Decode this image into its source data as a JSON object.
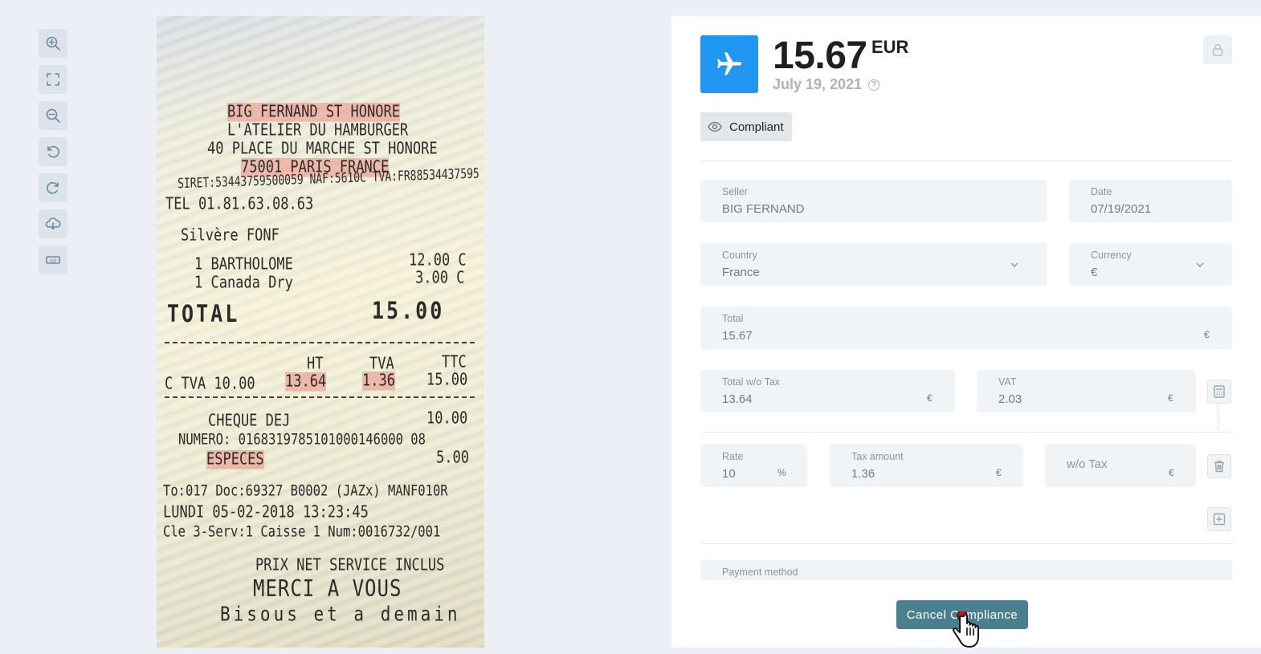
{
  "toolbar": {
    "items": [
      {
        "icon": "zoom-in-icon"
      },
      {
        "icon": "fullscreen-icon"
      },
      {
        "icon": "zoom-out-icon"
      },
      {
        "icon": "rotate-left-icon"
      },
      {
        "icon": "rotate-right-icon"
      },
      {
        "icon": "cloud-download-icon"
      },
      {
        "icon": "ocr-icon",
        "text": "A|B"
      }
    ]
  },
  "receipt": {
    "lines": {
      "store": "BIG FERNAND ST HONORE",
      "atelier": "L'ATELIER DU HAMBURGER",
      "address": "40 PLACE DU MARCHE ST HONORE",
      "city": "75001 PARIS FRANCE",
      "siret": "SIRET:53443759500059 NAF:5610C TVA:FR88534437595",
      "tel": "TEL 01.81.63.08.63",
      "server": "Silvère FONF",
      "item1_name": "1 BARTHOLOME",
      "item1_price": "12.00 C",
      "item2_name": "1 Canada Dry",
      "item2_price": "3.00 C",
      "total_label": "TOTAL",
      "total_value": "15.00",
      "hdr_ht": "HT",
      "hdr_tva": "TVA",
      "hdr_ttc": "TTC",
      "tva_label": "C TVA 10.00",
      "tva_ht": "13.64",
      "tva_tva": "1.36",
      "tva_ttc": "15.00",
      "cheque_label": "CHEQUE DEJ",
      "cheque_value": "10.00",
      "numero": "NUMERO: 0168319785101000146000 08",
      "especes_label": "ESPECES",
      "especes_value": "5.00",
      "doc": "To:017 Doc:69327    B0002  (JAZx) MANF010R",
      "datetime": "LUNDI 05-02-2018 13:23:45",
      "caisse": "Cle 3-Serv:1   Caisse 1   Num:0016732/001",
      "prix_net": "PRIX NET SERVICE INCLUS",
      "merci": "MERCI A VOUS",
      "bisous": "Bisous et a demain"
    }
  },
  "header": {
    "category_icon": "airplane-icon",
    "category_color": "#2196f3",
    "amount": "15.67",
    "currency_code": "EUR",
    "date": "July 19, 2021"
  },
  "status": {
    "label": "Compliant"
  },
  "form": {
    "seller": {
      "label": "Seller",
      "value": "BIG FERNAND"
    },
    "date": {
      "label": "Date",
      "value": "07/19/2021"
    },
    "country": {
      "label": "Country",
      "value": "France"
    },
    "currency": {
      "label": "Currency",
      "value": "€"
    },
    "total": {
      "label": "Total",
      "value": "15.67",
      "symbol": "€"
    },
    "total_wo_tax": {
      "label": "Total w/o Tax",
      "value": "13.64",
      "symbol": "€"
    },
    "vat": {
      "label": "VAT",
      "value": "2.03",
      "symbol": "€"
    },
    "rate": {
      "label": "Rate",
      "value": "10",
      "symbol": "%"
    },
    "tax_amount": {
      "label": "Tax amount",
      "value": "1.36",
      "symbol": "€"
    },
    "wo_tax": {
      "placeholder": "w/o Tax",
      "symbol": "€"
    },
    "payment_method": {
      "label": "Payment method"
    }
  },
  "actions": {
    "cancel_label": "Cancel Compliance"
  },
  "colors": {
    "accent": "#4a7f8f",
    "background": "#eceff6"
  }
}
